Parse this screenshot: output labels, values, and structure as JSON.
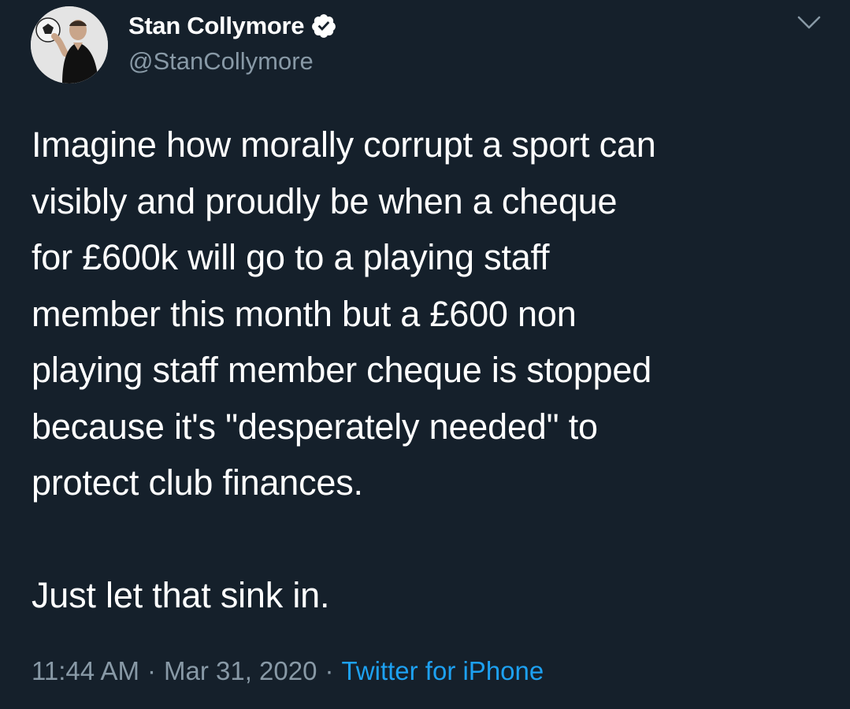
{
  "author": {
    "display_name": "Stan Collymore",
    "handle": "@StanCollymore",
    "verified_icon": "verified-badge-icon",
    "avatar_icon": "profile-avatar"
  },
  "tweet": {
    "text": "Imagine how morally corrupt a sport can\nvisibly and proudly be when  a cheque\nfor £600k will go to a playing staff\nmember this month but a £600 non\nplaying staff member cheque is stopped\nbecause it's \"desperately needed\" to\nprotect club finances.\n\nJust let that sink in.",
    "time": "11:44 AM",
    "date": "Mar 31, 2020",
    "source": "Twitter for iPhone",
    "separator": "·"
  },
  "menu": {
    "icon": "chevron-down-icon"
  },
  "colors": {
    "background": "#15202b",
    "primary_text": "#ffffff",
    "secondary_text": "#8899a6",
    "accent": "#1da1f2"
  }
}
